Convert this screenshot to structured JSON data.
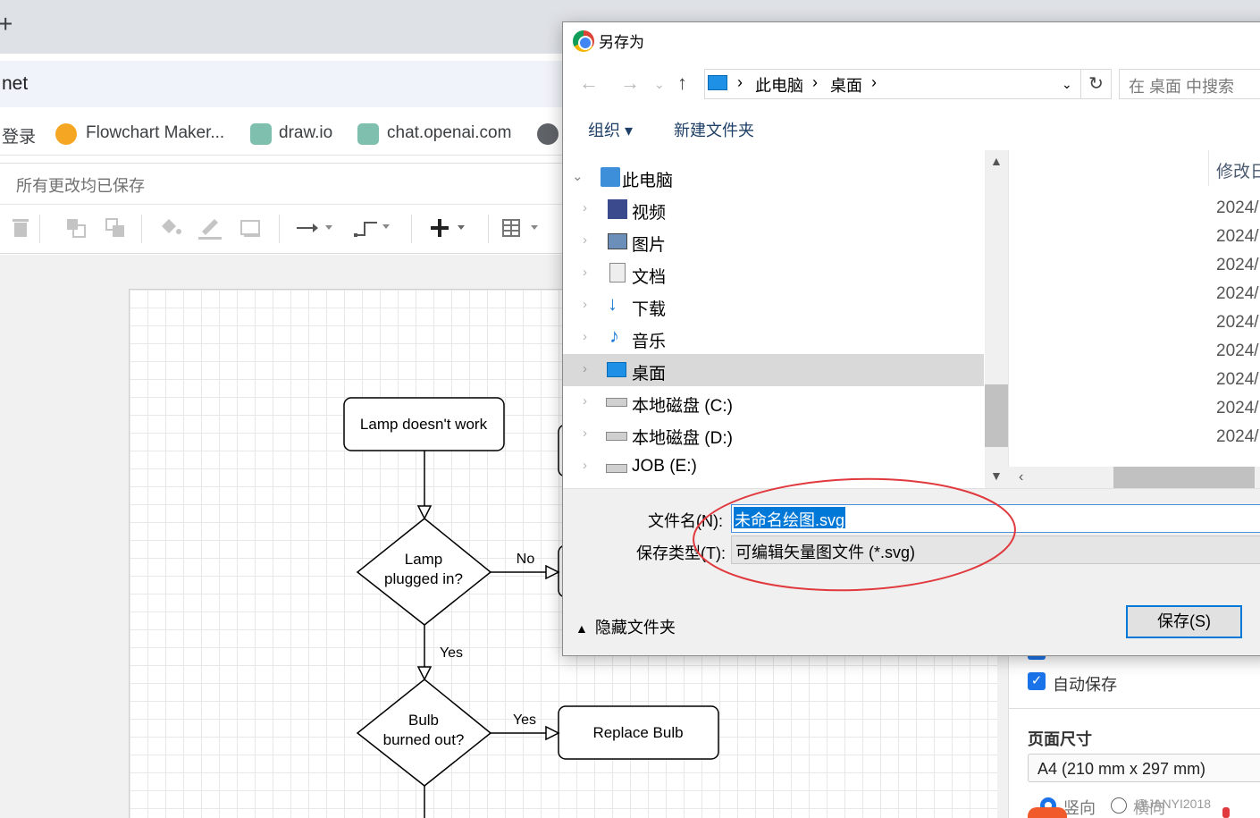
{
  "browser": {
    "new_tab_glyph": "+",
    "address_text": "net",
    "bookmarks": [
      {
        "label": "登录"
      },
      {
        "label": "Flowchart Maker..."
      },
      {
        "label": "draw.io"
      },
      {
        "label": "chat.openai.com"
      }
    ]
  },
  "app": {
    "saved_status": "所有更改均已保存",
    "flowchart": {
      "nodes": [
        "Lamp doesn't work",
        "Lamp",
        "plugged in?",
        "Bulb",
        "burned out?",
        "Replace Bulb"
      ],
      "edge_labels": [
        "No",
        "Yes",
        "Yes"
      ]
    },
    "panel": {
      "autosave_label": "自动保存",
      "page_size_heading": "页面尺寸",
      "page_size_value": "A4 (210 mm x 297 mm)",
      "orientation_portrait": "竖向",
      "orientation_landscape": "横向"
    }
  },
  "dialog": {
    "title": "另存为",
    "breadcrumb": [
      "此电脑",
      "桌面"
    ],
    "search_placeholder": "在 桌面 中搜索",
    "organize_label": "组织 ▾",
    "new_folder_label": "新建文件夹",
    "tree": [
      {
        "label": "此电脑",
        "icon": "computer-icon"
      },
      {
        "label": "视频",
        "icon": "video-icon"
      },
      {
        "label": "图片",
        "icon": "picture-icon"
      },
      {
        "label": "文档",
        "icon": "document-icon"
      },
      {
        "label": "下载",
        "icon": "download-icon"
      },
      {
        "label": "音乐",
        "icon": "music-icon"
      },
      {
        "label": "桌面",
        "icon": "desktop-icon",
        "selected": true
      },
      {
        "label": "本地磁盘 (C:)",
        "icon": "drive-icon"
      },
      {
        "label": "本地磁盘 (D:)",
        "icon": "drive-icon"
      },
      {
        "label": "JOB (E:)",
        "icon": "drive-warning-icon"
      }
    ],
    "list_header": "修改日",
    "dates": [
      "2024/",
      "2024/",
      "2024/",
      "2024/",
      "2024/",
      "2024/",
      "2024/",
      "2024/",
      "2024/"
    ],
    "filename_label": "文件名(N):",
    "filename_value": "未命名绘图.svg",
    "filetype_label": "保存类型(T):",
    "filetype_value": "可编辑矢量图文件 (*.svg)",
    "hide_folders_label": "隐藏文件夹",
    "save_button": "保存(S)",
    "annotation_color": "#e0393e"
  },
  "watermark": "@JANYI2018"
}
